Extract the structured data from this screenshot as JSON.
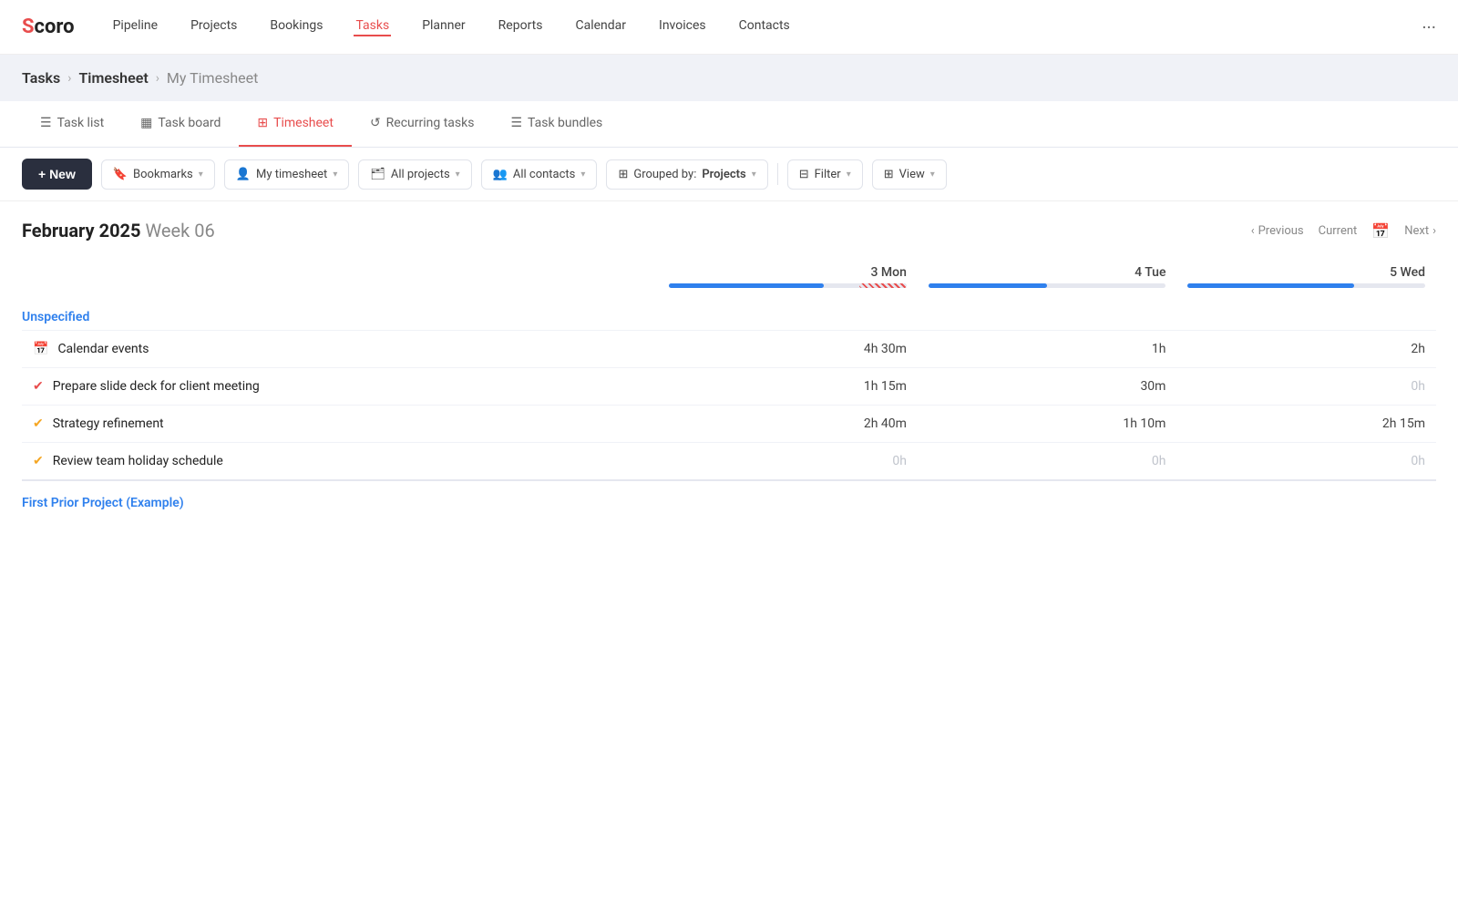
{
  "logo": {
    "text": "Scoro",
    "s": "S"
  },
  "nav": {
    "items": [
      {
        "label": "Pipeline",
        "active": false
      },
      {
        "label": "Projects",
        "active": false
      },
      {
        "label": "Bookings",
        "active": false
      },
      {
        "label": "Tasks",
        "active": true
      },
      {
        "label": "Planner",
        "active": false
      },
      {
        "label": "Reports",
        "active": false
      },
      {
        "label": "Calendar",
        "active": false
      },
      {
        "label": "Invoices",
        "active": false
      },
      {
        "label": "Contacts",
        "active": false
      }
    ],
    "more": "···"
  },
  "breadcrumb": {
    "items": [
      {
        "label": "Tasks",
        "light": false
      },
      {
        "label": "Timesheet",
        "light": false
      },
      {
        "label": "My Timesheet",
        "light": true
      }
    ]
  },
  "tabs": [
    {
      "label": "Task list",
      "icon": "☰",
      "active": false
    },
    {
      "label": "Task board",
      "icon": "⊞",
      "active": false
    },
    {
      "label": "Timesheet",
      "icon": "⊞",
      "active": true
    },
    {
      "label": "Recurring tasks",
      "icon": "↺",
      "active": false
    },
    {
      "label": "Task bundles",
      "icon": "☰",
      "active": false
    }
  ],
  "toolbar": {
    "new_label": "+ New",
    "bookmarks": "Bookmarks",
    "my_timesheet": "My timesheet",
    "all_projects": "All projects",
    "all_contacts": "All contacts",
    "grouped_by": "Grouped by:",
    "grouped_value": "Projects",
    "filter": "Filter",
    "view": "View"
  },
  "week": {
    "month": "February 2025",
    "week": "Week 06",
    "prev_label": "Previous",
    "next_label": "Next",
    "current_label": "Current"
  },
  "days": [
    {
      "label": "3 Mon",
      "fill_pct": 65,
      "overflow_pct": 20
    },
    {
      "label": "4 Tue",
      "fill_pct": 50,
      "overflow_pct": 0
    },
    {
      "label": "5 Wed",
      "fill_pct": 70,
      "overflow_pct": 0
    }
  ],
  "sections": [
    {
      "name": "Unspecified",
      "tasks": [
        {
          "name": "Calendar events",
          "icon": "calendar",
          "check": "none",
          "times": [
            "4h 30m",
            "1h",
            "2h"
          ]
        },
        {
          "name": "Prepare slide deck for client meeting",
          "icon": "none",
          "check": "red",
          "times": [
            "1h 15m",
            "30m",
            "0h"
          ]
        },
        {
          "name": "Strategy refinement",
          "icon": "none",
          "check": "yellow",
          "times": [
            "2h 40m",
            "1h 10m",
            "2h 15m"
          ]
        },
        {
          "name": "Review team holiday schedule",
          "icon": "none",
          "check": "yellow",
          "times": [
            "0h",
            "0h",
            "0h"
          ]
        }
      ]
    }
  ],
  "next_section_label": "First Prior Project (Example)",
  "zero_color": "#c0c4cc"
}
